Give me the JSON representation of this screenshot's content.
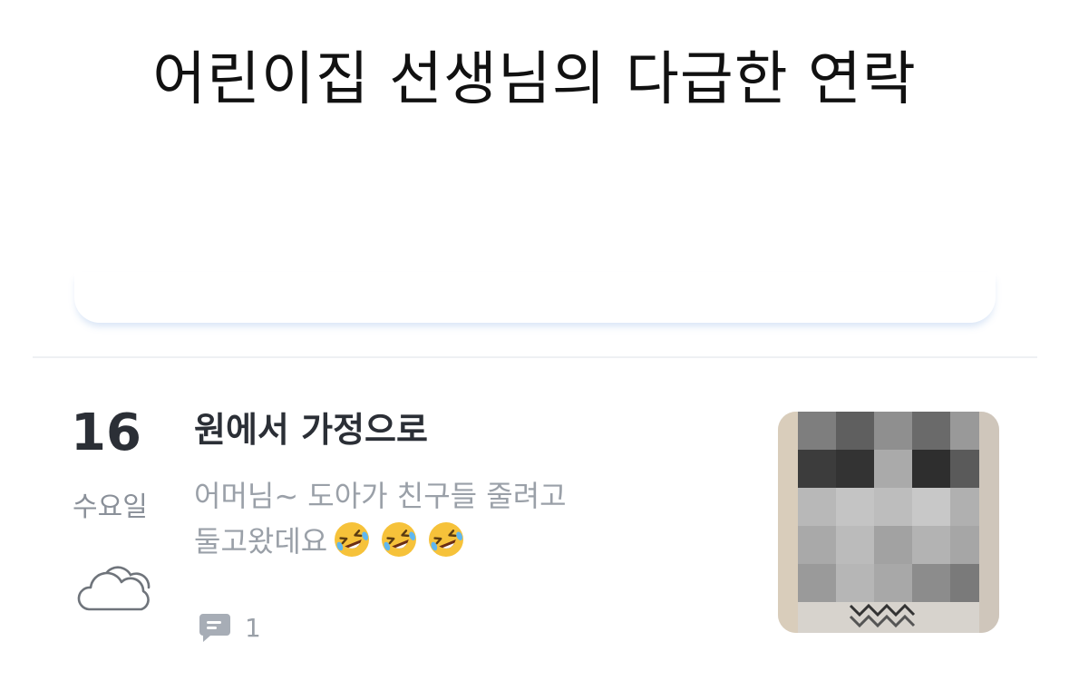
{
  "headline": "어린이집 선생님의 다급한 연락",
  "entry": {
    "day": "16",
    "weekday": "수요일",
    "weather_icon": "cloud-icon",
    "title": "원에서 가정으로",
    "body_line1": "어머님~ 도아가 친구들 줄려고",
    "body_line2": "둘고왔데요",
    "emoji_icon": "rolling-on-floor-laughing-emoji",
    "comment_icon": "comment-icon",
    "comment_count": "1",
    "thumbnail": "pixelated-photo"
  },
  "colors": {
    "text_dark": "#2b2f36",
    "text_muted": "#9aa0a8",
    "divider": "#eef0f3",
    "emoji_face": "#f6c23a"
  }
}
